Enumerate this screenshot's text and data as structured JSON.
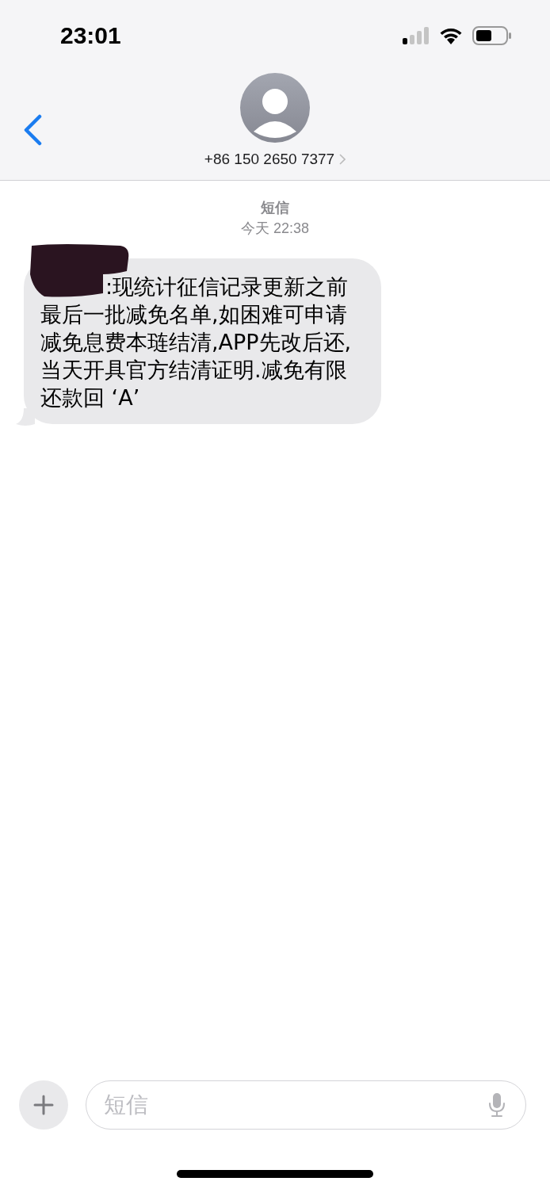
{
  "status_bar": {
    "time": "23:01"
  },
  "header": {
    "contact": "+86 150 2650 7377"
  },
  "thread": {
    "service": "短信",
    "timestamp": "今天 22:38",
    "messages": [
      {
        "kind": "incoming",
        "redacted": true,
        "lines": [
          ":现统计征信记录更新之前",
          "最后一批减免名单,如困难可申请",
          "减免息费本琏结清,APP先改后还,",
          "当天开具官方结清证明.减免有限",
          "还款回 ‘A’"
        ]
      }
    ]
  },
  "composer": {
    "placeholder": "短信"
  }
}
